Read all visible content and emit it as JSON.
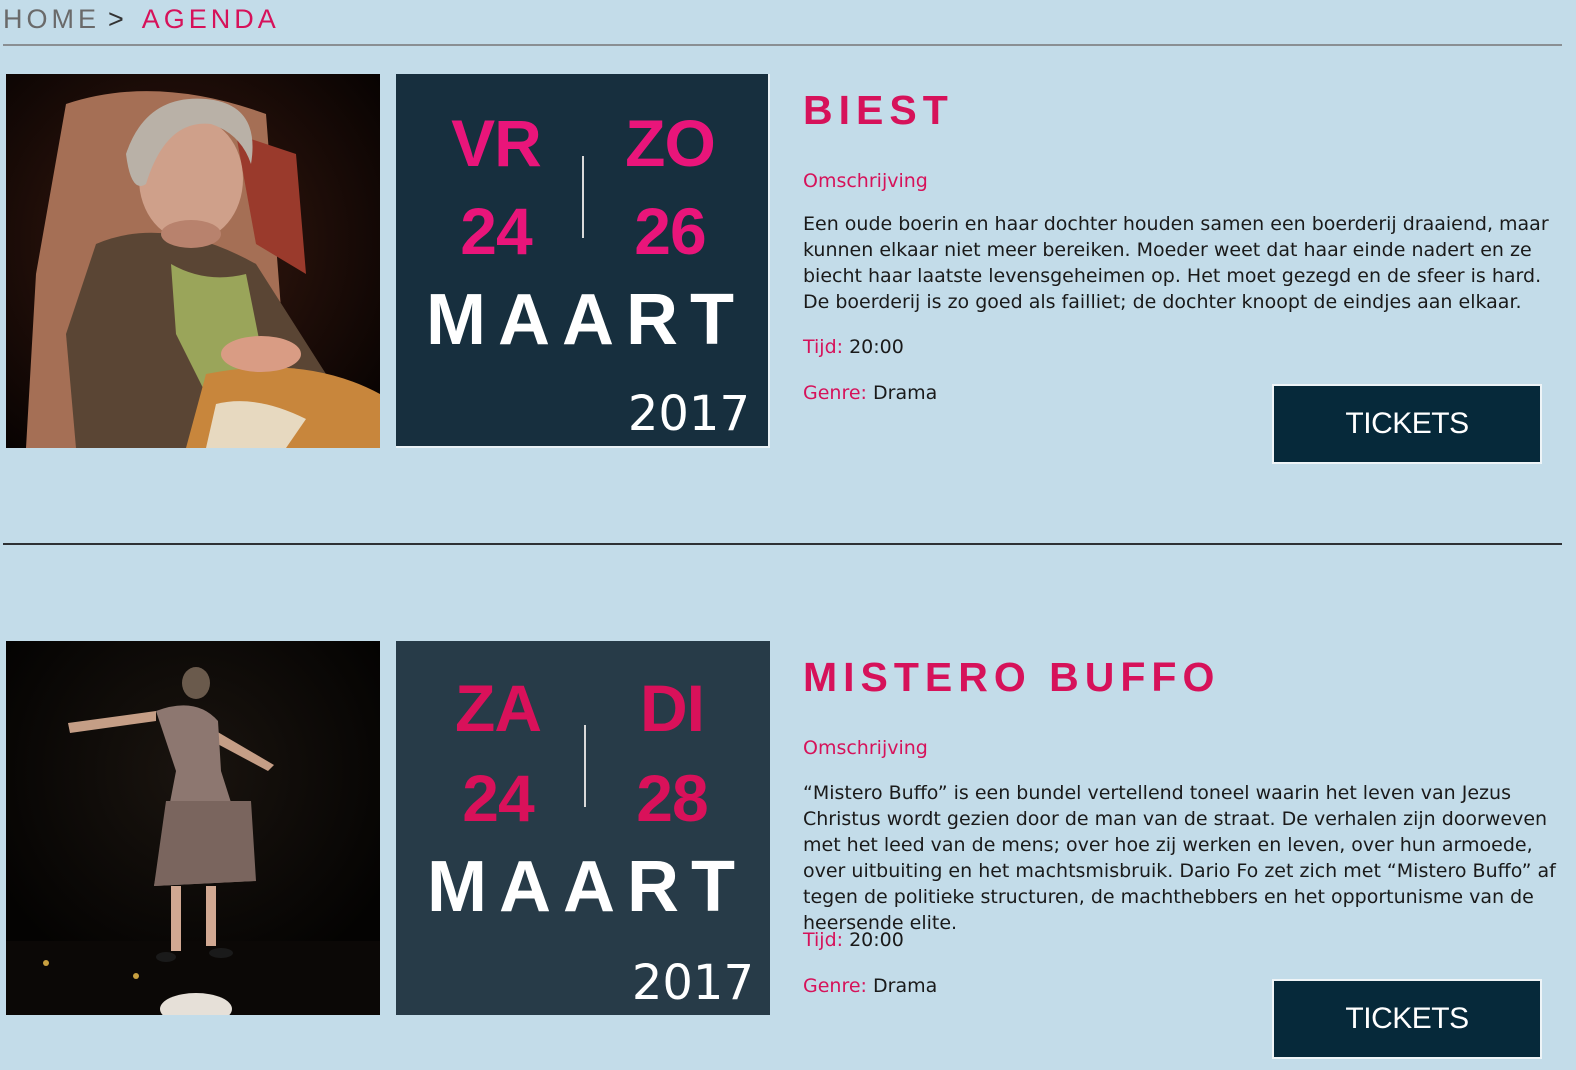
{
  "breadcrumb": {
    "home": "HOME",
    "separator": ">",
    "current": "AGENDA"
  },
  "events": [
    {
      "title": "BIEST",
      "image_alt": "Oudere vrouw in een fauteuil",
      "datecard": {
        "background": "#172f3e",
        "day_color": "#e9157a",
        "start_day_abbr": "VR",
        "start_day_num": "24",
        "end_day_abbr": "ZO",
        "end_day_num": "26",
        "month": "MAART",
        "year": "2017"
      },
      "omschrijving_label": "Omschrijving",
      "description": "Een oude boerin en haar dochter houden samen een boerderij draaiend, maar kunnen elkaar niet meer bereiken. Moeder weet dat haar einde nadert en ze biecht haar laatste levensgeheimen op. Het moet gezegd en de sfeer is hard. De boerderij is zo goed als failliet; de dochter knoopt de eindjes aan elkaar.",
      "time_label": "Tijd:",
      "time_value": "20:00",
      "genre_label": "Genre:",
      "genre_value": "Drama",
      "tickets_label": "TICKETS"
    },
    {
      "title": "MISTERO BUFFO",
      "image_alt": "Vrouw in jurk met gespreide armen op het podium",
      "datecard": {
        "background": "#273b48",
        "day_color": "#d9115a",
        "start_day_abbr": "ZA",
        "start_day_num": "24",
        "end_day_abbr": "DI",
        "end_day_num": "28",
        "month": "MAART",
        "year": "2017"
      },
      "omschrijving_label": "Omschrijving",
      "description": "“Mistero Buffo” is een bundel vertellend toneel waarin het leven van Jezus Christus wordt gezien door de man van de straat. De verhalen zijn doorweven met het leed van de mens; over hoe zij werken en leven, over hun armoede, over uitbuiting en het machtsmisbruik. Dario Fo zet zich met “Mistero Buffo” af tegen de politieke structuren, de machthebbers en het opportunisme van de heersende elite.",
      "time_label": "Tijd:",
      "time_value": "20:00",
      "genre_label": "Genre:",
      "genre_value": "Drama",
      "tickets_label": "TICKETS"
    }
  ],
  "colors": {
    "page_background": "#c3dce9",
    "accent": "#d6125a",
    "button_background": "#06293a"
  }
}
